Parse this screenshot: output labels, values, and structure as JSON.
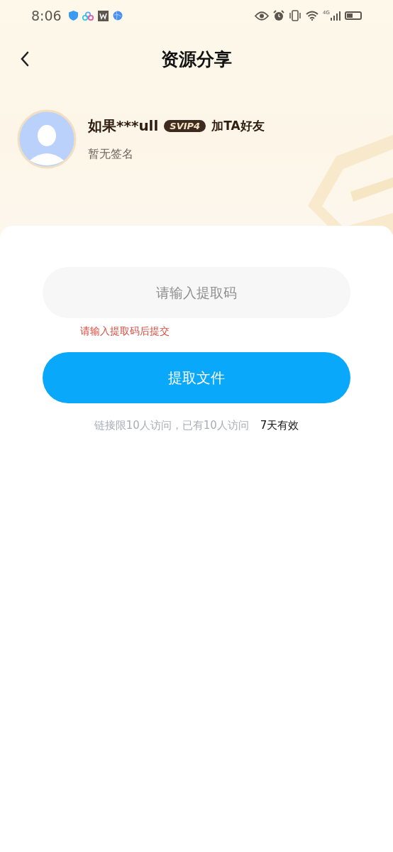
{
  "status_bar": {
    "time": "8:06",
    "network": "4G"
  },
  "header": {
    "title": "资源分享"
  },
  "profile": {
    "name": "如果***ull",
    "badge": "SVIP4",
    "add_friend": "加TA好友",
    "signature": "暂无签名"
  },
  "form": {
    "placeholder": "请输入提取码",
    "error": "请输入提取码后提交",
    "button": "提取文件"
  },
  "footer": {
    "access": "链接限10人访问，已有10人访问",
    "validity": "7天有效"
  }
}
